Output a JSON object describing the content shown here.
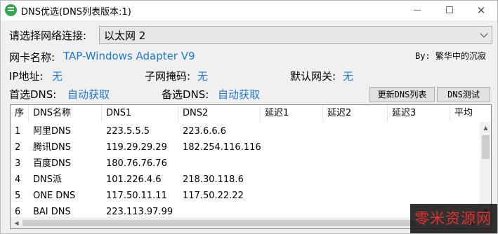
{
  "window": {
    "title": "DNS优选(DNS列表版本:1)",
    "minimize": "—",
    "close": "✕"
  },
  "network": {
    "label": "请选择网络连接:",
    "selected": "以太网 2"
  },
  "adapter": {
    "label": "网卡名称:",
    "value": "TAP-Windows Adapter V9",
    "author": "By: 繁华中的沉寂"
  },
  "ip": {
    "ip_label": "IP地址:",
    "ip_value": "无",
    "mask_label": "子网掩码:",
    "mask_value": "无",
    "gateway_label": "默认网关:",
    "gateway_value": "无"
  },
  "dns": {
    "primary_label": "首选DNS:",
    "primary_value": "自动获取",
    "secondary_label": "备选DNS:",
    "secondary_value": "自动获取",
    "update_button": "更新DNS列表",
    "test_button": "DNS测试"
  },
  "table": {
    "columns": [
      "序",
      "DNS名称",
      "DNS1",
      "DNS2",
      "延迟1",
      "延迟2",
      "延迟3",
      "平均"
    ],
    "rows": [
      [
        "1",
        "阿里DNS",
        "223.5.5.5",
        "223.6.6.6",
        "",
        "",
        "",
        ""
      ],
      [
        "2",
        "腾讯DNS",
        "119.29.29.29",
        "182.254.116.116",
        "",
        "",
        "",
        ""
      ],
      [
        "3",
        "百度DNS",
        "180.76.76.76",
        "",
        "",
        "",
        "",
        ""
      ],
      [
        "4",
        "DNS派",
        "101.226.4.6",
        "218.30.118.6",
        "",
        "",
        "",
        ""
      ],
      [
        "5",
        "ONE DNS",
        "117.50.11.11",
        "117.50.22.22",
        "",
        "",
        "",
        ""
      ],
      [
        "6",
        "BAI DNS",
        "223.113.97.99",
        "",
        "",
        "",
        "",
        ""
      ]
    ]
  },
  "watermark": "零米资源网",
  "colors": {
    "link_blue": "#1f79d1",
    "watermark_red": "#e0302f"
  }
}
